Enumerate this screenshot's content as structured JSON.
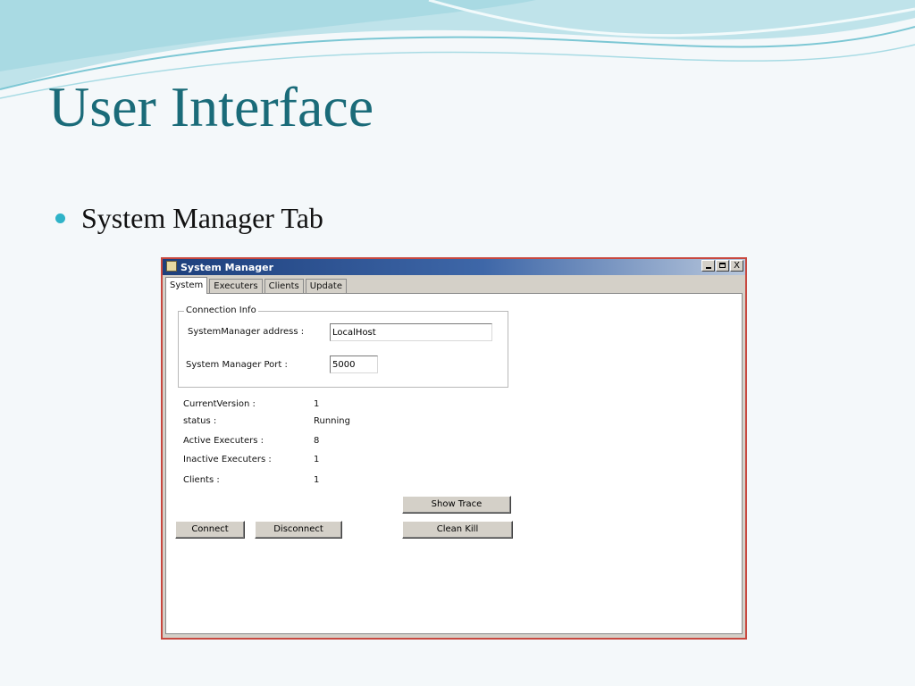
{
  "slide": {
    "title": "User Interface",
    "bullet": "System Manager Tab"
  },
  "window": {
    "title": "System Manager",
    "controls": [
      "minimize-icon",
      "maximize-icon",
      "close-icon"
    ],
    "close_glyph": "X"
  },
  "tabs": [
    {
      "label": "System",
      "active": true
    },
    {
      "label": "Executers",
      "active": false
    },
    {
      "label": "Clients",
      "active": false
    },
    {
      "label": "Update",
      "active": false
    }
  ],
  "connection": {
    "legend": "Connection Info",
    "address_label": "SystemManager address :",
    "address_value": "LocalHost",
    "port_label": "System Manager  Port :",
    "port_value": "5000"
  },
  "info": [
    {
      "label": "CurrentVersion :",
      "value": "1"
    },
    {
      "label": "status :",
      "value": "Running"
    },
    {
      "label": "Active Executers :",
      "value": "8"
    },
    {
      "label": "Inactive Executers :",
      "value": "1"
    },
    {
      "label": "Clients :",
      "value": "1"
    }
  ],
  "buttons": {
    "connect": "Connect",
    "disconnect": "Disconnect",
    "show_trace": "Show Trace",
    "clean_kill": "Clean Kill"
  },
  "colors": {
    "title": "#1a6b79",
    "bullet": "#2fb3c8",
    "window_border": "#c8483f",
    "titlebar": "#1d3f7c"
  }
}
